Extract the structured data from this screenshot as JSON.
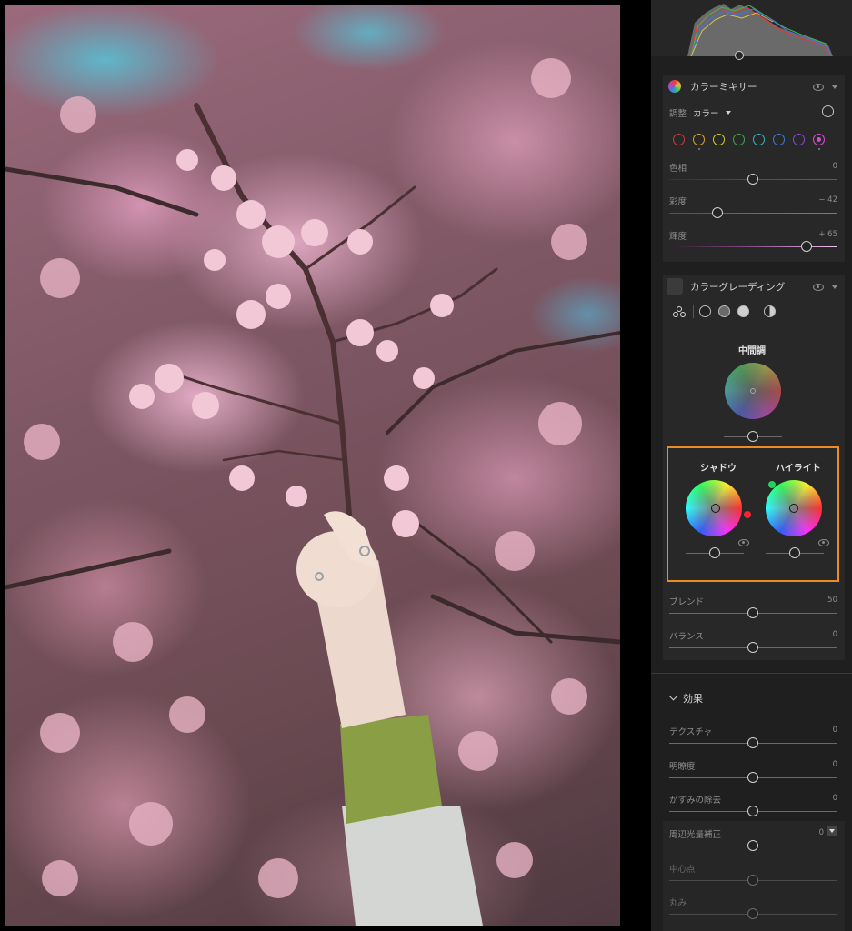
{
  "color_mixer": {
    "title": "カラーミキサー",
    "adjust_label": "調整",
    "adjust_value": "カラー",
    "swatches": [
      {
        "color": "#d23a3a",
        "active": false
      },
      {
        "color": "#e0a32a",
        "active": false
      },
      {
        "color": "#d6cc2a",
        "active": false
      },
      {
        "color": "#3aa84a",
        "active": false
      },
      {
        "color": "#2fb6c4",
        "active": false
      },
      {
        "color": "#3a7ce0",
        "active": false
      },
      {
        "color": "#8a4ad6",
        "active": false
      },
      {
        "color": "#d94ad0",
        "active": true
      }
    ],
    "hue": {
      "label": "色相",
      "value": "0",
      "level": 0.5
    },
    "saturation": {
      "label": "彩度",
      "value": "− 42",
      "level": 0.29
    },
    "luminance": {
      "label": "輝度",
      "value": "+ 65",
      "level": 0.82
    }
  },
  "color_grading": {
    "title": "カラーグレーディング",
    "midtones": {
      "label": "中間調",
      "level": 0.5
    },
    "shadows": {
      "label": "シャドウ",
      "level": 0.5
    },
    "highlights": {
      "label": "ハイライト",
      "level": 0.5
    },
    "blend": {
      "label": "ブレンド",
      "value": "50",
      "level": 0.5
    },
    "balance": {
      "label": "バランス",
      "value": "0",
      "level": 0.5
    }
  },
  "effects": {
    "title": "効果",
    "texture": {
      "label": "テクスチャ",
      "value": "0",
      "level": 0.5
    },
    "clarity": {
      "label": "明瞭度",
      "value": "0",
      "level": 0.5
    },
    "dehaze": {
      "label": "かすみの除去",
      "value": "0",
      "level": 0.5
    },
    "vignette": {
      "label": "周辺光量補正",
      "value": "0",
      "level": 0.5
    },
    "midpoint": {
      "label": "中心点",
      "level": 0.5
    },
    "roundness": {
      "label": "丸み",
      "level": 0.5
    }
  }
}
